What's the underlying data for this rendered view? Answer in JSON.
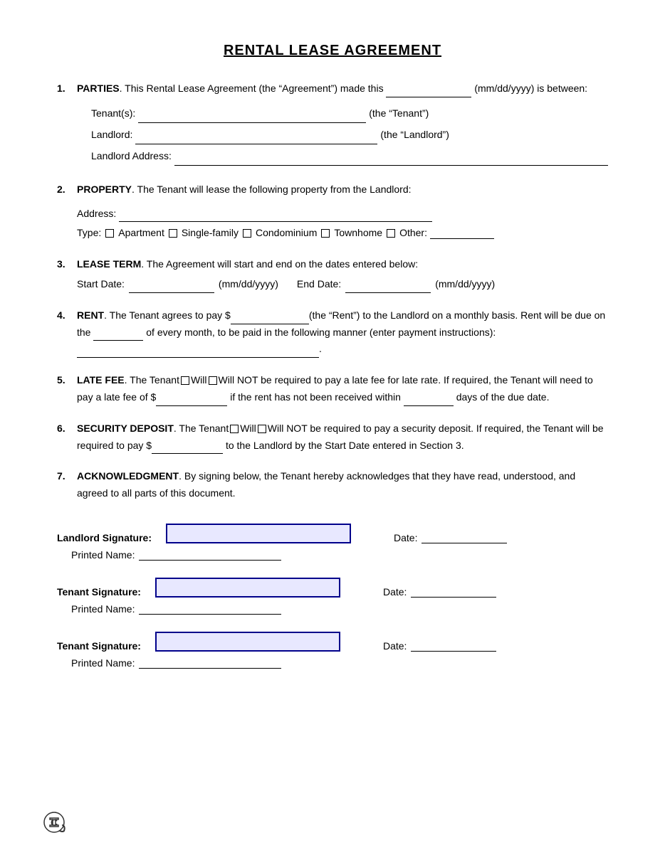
{
  "document": {
    "title": "RENTAL LEASE AGREEMENT",
    "sections": [
      {
        "num": "1.",
        "heading": "PARTIES",
        "text_before": ". This Rental Lease Agreement (the “Agreement”) made this",
        "date_field": "",
        "text_after": "(mm/dd/yyyy) is between:",
        "fields": {
          "tenant_label": "Tenant(s):",
          "tenant_suffix": "(the “Tenant”)",
          "landlord_label": "Landlord:",
          "landlord_suffix": "(the “Landlord”)",
          "landlord_address_label": "Landlord Address:"
        }
      },
      {
        "num": "2.",
        "heading": "PROPERTY",
        "text": ". The Tenant will lease the following property from the Landlord:",
        "address_label": "Address:",
        "type_label": "Type:",
        "types": [
          "Apartment",
          "Single-family",
          "Condominium",
          "Townhome",
          "Other:"
        ]
      },
      {
        "num": "3.",
        "heading": "LEASE TERM",
        "text": ". The Agreement will start and end on the dates entered below:",
        "start_label": "Start Date:",
        "start_format": "(mm/dd/yyyy)",
        "end_label": "End Date:",
        "end_format": "(mm/dd/yyyy)"
      },
      {
        "num": "4.",
        "heading": "RENT",
        "text": ". The Tenant agrees to pay $",
        "text2": "(the “Rent”) to the Landlord on a monthly basis. Rent will be due on the",
        "text3": "of every month, to be paid in the following manner (enter payment instructions):",
        "dot": "."
      },
      {
        "num": "5.",
        "heading": "LATE FEE",
        "text_intro": ". The Tenant",
        "will_label": "Will",
        "will_not_label": "Will NOT",
        "text_rest": "be required to pay a late fee for late rate. If required, the Tenant will need to pay a late fee of $",
        "text_rest2": "if the rent has not been received within",
        "text_rest3": "days of the due date."
      },
      {
        "num": "6.",
        "heading": "SECURITY DEPOSIT",
        "text_intro": ". The Tenant",
        "will_label": "Will",
        "will_not_label": "Will NOT",
        "text_rest": "be required to pay a security deposit. If required, the Tenant will be required to pay $",
        "text_rest2": "to the Landlord by the Start Date entered in Section 3."
      },
      {
        "num": "7.",
        "heading": "ACKNOWLEDGMENT",
        "text": ". By signing below, the Tenant hereby acknowledges that they have read, understood, and agreed to all parts of this document."
      }
    ],
    "signatures": [
      {
        "label": "Landlord Signature:",
        "printed_name_label": "Printed Name:",
        "date_label": "Date:"
      },
      {
        "label": "Tenant Signature:",
        "printed_name_label": "Printed Name:",
        "date_label": "Date:"
      },
      {
        "label": "Tenant Signature:",
        "printed_name_label": "Printed Name:",
        "date_label": "Date:"
      }
    ],
    "watermark": "C"
  }
}
